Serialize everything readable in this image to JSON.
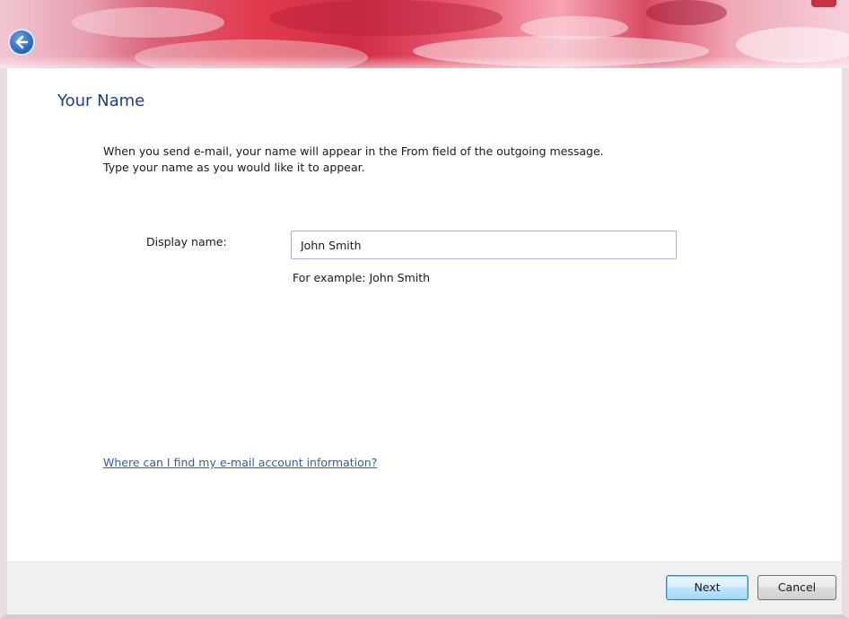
{
  "wizard": {
    "page_title": "Your Name",
    "instructions_line1": "When you send e-mail, your name will appear in the From field of the outgoing message.",
    "instructions_line2": "Type your name as you would like it to appear.",
    "display_name_label": "Display name:",
    "display_name_value": "John Smith",
    "example_text": "For example: John Smith",
    "help_link": "Where can I find my e-mail account information?"
  },
  "footer": {
    "next_label": "Next",
    "cancel_label": "Cancel"
  },
  "icons": {
    "back": "back-arrow-icon"
  },
  "colors": {
    "title": "#1e3f8a",
    "link": "#2a5fb5",
    "accent_header": "#e23a4e"
  }
}
